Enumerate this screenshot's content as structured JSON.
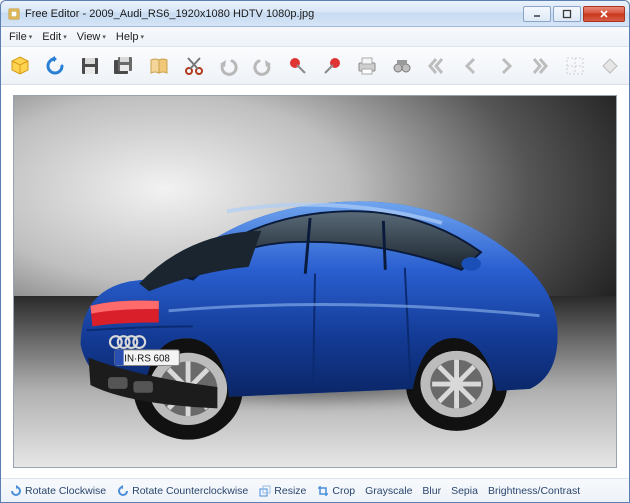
{
  "titlebar": {
    "app_name": "Free Editor",
    "separator": " - ",
    "document": "2009_Audi_RS6_1920x1080 HDTV 1080p.jpg"
  },
  "menus": {
    "file": "File",
    "edit": "Edit",
    "view": "View",
    "help": "Help"
  },
  "toolbar": {
    "new": "New",
    "refresh": "Refresh",
    "save": "Save",
    "save_as": "Save As",
    "book": "Book",
    "cut": "Cut",
    "undo": "Undo",
    "redo": "Redo",
    "pin_left": "Pin",
    "pin_right": "Unpin",
    "print": "Print",
    "find": "Find",
    "first": "First",
    "prev": "Previous",
    "next": "Next",
    "last": "Last",
    "grid": "Grid",
    "diamond": "Options"
  },
  "status": {
    "rotate_cw": "Rotate Clockwise",
    "rotate_ccw": "Rotate Counterclockwise",
    "resize": "Resize",
    "crop": "Crop",
    "grayscale": "Grayscale",
    "blur": "Blur",
    "sepia": "Sepia",
    "brightness": "Brightness/Contrast"
  },
  "image": {
    "description": "Blue Audi RS6 sedan rear three-quarter view",
    "license_plate": "IN·RS 608"
  }
}
